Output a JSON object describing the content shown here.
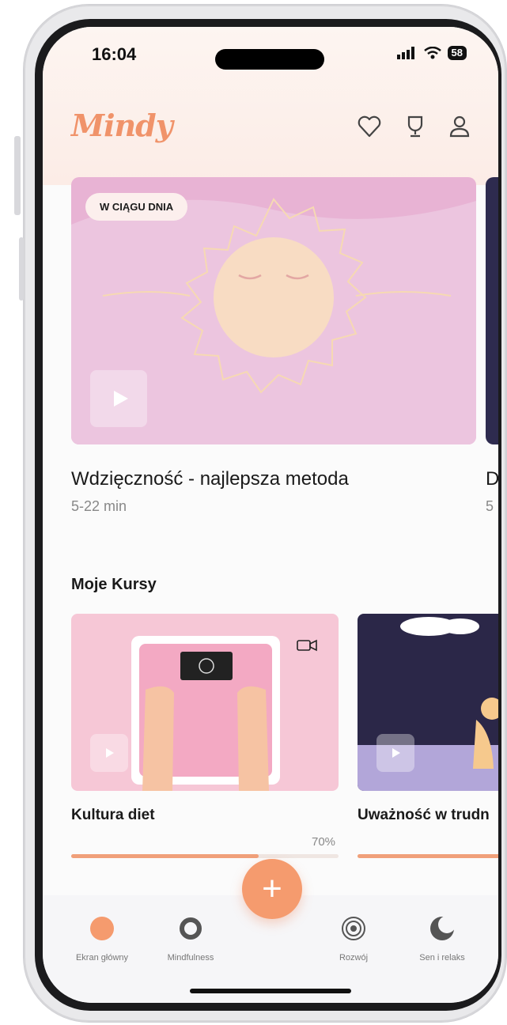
{
  "status": {
    "time": "16:04",
    "battery": "58"
  },
  "app": {
    "logo": "Mindy"
  },
  "header_icons": [
    "heart-icon",
    "trophy-icon",
    "user-icon"
  ],
  "featured": [
    {
      "badge": "W CIĄGU DNIA",
      "title": "Wdzięczność - najlepsza metoda",
      "subtitle": "5-22 min"
    },
    {
      "title": "D",
      "subtitle": "5"
    }
  ],
  "courses_section": {
    "title": "Moje Kursy"
  },
  "courses": [
    {
      "name": "Kultura diet",
      "progress_label": "70%",
      "progress": 0.7
    },
    {
      "name": "Uważność w trudn",
      "progress": 1.0
    }
  ],
  "nav": {
    "items": [
      {
        "label": "Ekran główny"
      },
      {
        "label": "Mindfulness"
      },
      {
        "label": "Rozwój"
      },
      {
        "label": "Sen i relaks"
      }
    ],
    "fab": "+"
  },
  "colors": {
    "accent": "#f59b6e",
    "card_pink": "#e8b3d4",
    "card_navy": "#2e2b4f"
  }
}
